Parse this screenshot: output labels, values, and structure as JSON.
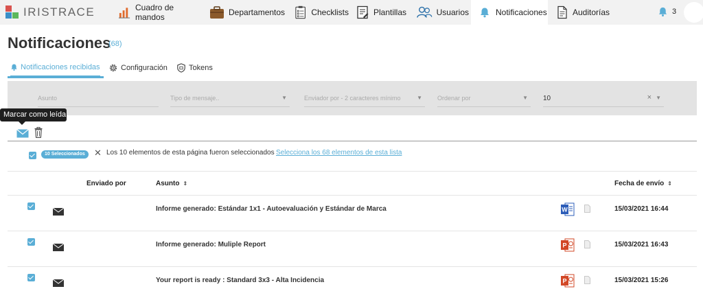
{
  "app": {
    "logo_text": "IRISTRACE"
  },
  "nav": {
    "items": [
      {
        "label": "Cuadro de mandos",
        "icon": "bar-chart-icon"
      },
      {
        "label": "Departamentos",
        "icon": "briefcase-icon"
      },
      {
        "label": "Checklists",
        "icon": "checklist-icon"
      },
      {
        "label": "Plantillas",
        "icon": "template-icon"
      },
      {
        "label": "Usuarios",
        "icon": "users-icon"
      },
      {
        "label": "Notificaciones",
        "icon": "bell-icon"
      },
      {
        "label": "Auditorías",
        "icon": "document-icon"
      }
    ],
    "active": "Notificaciones",
    "notification_count": "3"
  },
  "page": {
    "title": "Notificaciones",
    "count": "(68)"
  },
  "tabs": [
    {
      "label": "Notificaciones recibidas",
      "icon": "bell-icon",
      "active": true
    },
    {
      "label": "Configuración",
      "icon": "gear-icon",
      "active": false
    },
    {
      "label": "Tokens",
      "icon": "shield-icon",
      "active": false
    }
  ],
  "filters": {
    "subject_placeholder": "Asunto",
    "message_type_placeholder": "Tipo de mensaje..",
    "sender_placeholder": "Enviador por - 2 caracteres mínimo",
    "order_placeholder": "Ordenar por",
    "page_size_value": "10"
  },
  "tooltip": {
    "text": "Marcar como leída"
  },
  "selection": {
    "badge": "10 Seleccionados",
    "text": "Los 10 elementos de esta página fueron seleccionados",
    "link": "Selecciona los 68 elementos de esta lista"
  },
  "table": {
    "headers": {
      "sender": "Enviado por",
      "subject": "Asunto",
      "date": "Fecha de envío"
    },
    "rows": [
      {
        "subject": "Informe generado: Estándar 1x1 - Autoevaluación y Estándar de Marca",
        "file_type": "word",
        "date": "15/03/2021 16:44",
        "checked": true
      },
      {
        "subject": "Informe generado: Muliple Report",
        "file_type": "powerpoint",
        "date": "15/03/2021 16:43",
        "checked": true
      },
      {
        "subject": "Your report is ready : Standard 3x3 - Alta Incidencia",
        "file_type": "powerpoint",
        "date": "15/03/2021 15:26",
        "checked": true
      }
    ]
  },
  "colors": {
    "accent": "#5aaed6",
    "nav_bg": "#f2f2f2",
    "filter_bg": "#e3e3e3",
    "word": "#2b5cb8",
    "powerpoint": "#d24726"
  }
}
